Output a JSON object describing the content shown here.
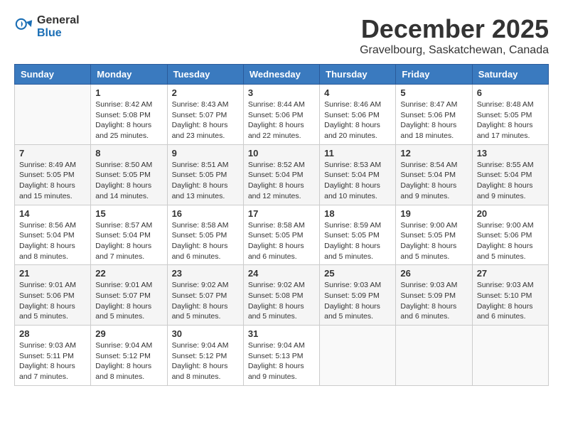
{
  "header": {
    "logo_line1": "General",
    "logo_line2": "Blue",
    "month": "December 2025",
    "location": "Gravelbourg, Saskatchewan, Canada"
  },
  "days_of_week": [
    "Sunday",
    "Monday",
    "Tuesday",
    "Wednesday",
    "Thursday",
    "Friday",
    "Saturday"
  ],
  "weeks": [
    [
      {
        "day": "",
        "sunrise": "",
        "sunset": "",
        "daylight": ""
      },
      {
        "day": "1",
        "sunrise": "Sunrise: 8:42 AM",
        "sunset": "Sunset: 5:08 PM",
        "daylight": "Daylight: 8 hours and 25 minutes."
      },
      {
        "day": "2",
        "sunrise": "Sunrise: 8:43 AM",
        "sunset": "Sunset: 5:07 PM",
        "daylight": "Daylight: 8 hours and 23 minutes."
      },
      {
        "day": "3",
        "sunrise": "Sunrise: 8:44 AM",
        "sunset": "Sunset: 5:06 PM",
        "daylight": "Daylight: 8 hours and 22 minutes."
      },
      {
        "day": "4",
        "sunrise": "Sunrise: 8:46 AM",
        "sunset": "Sunset: 5:06 PM",
        "daylight": "Daylight: 8 hours and 20 minutes."
      },
      {
        "day": "5",
        "sunrise": "Sunrise: 8:47 AM",
        "sunset": "Sunset: 5:06 PM",
        "daylight": "Daylight: 8 hours and 18 minutes."
      },
      {
        "day": "6",
        "sunrise": "Sunrise: 8:48 AM",
        "sunset": "Sunset: 5:05 PM",
        "daylight": "Daylight: 8 hours and 17 minutes."
      }
    ],
    [
      {
        "day": "7",
        "sunrise": "Sunrise: 8:49 AM",
        "sunset": "Sunset: 5:05 PM",
        "daylight": "Daylight: 8 hours and 15 minutes."
      },
      {
        "day": "8",
        "sunrise": "Sunrise: 8:50 AM",
        "sunset": "Sunset: 5:05 PM",
        "daylight": "Daylight: 8 hours and 14 minutes."
      },
      {
        "day": "9",
        "sunrise": "Sunrise: 8:51 AM",
        "sunset": "Sunset: 5:05 PM",
        "daylight": "Daylight: 8 hours and 13 minutes."
      },
      {
        "day": "10",
        "sunrise": "Sunrise: 8:52 AM",
        "sunset": "Sunset: 5:04 PM",
        "daylight": "Daylight: 8 hours and 12 minutes."
      },
      {
        "day": "11",
        "sunrise": "Sunrise: 8:53 AM",
        "sunset": "Sunset: 5:04 PM",
        "daylight": "Daylight: 8 hours and 10 minutes."
      },
      {
        "day": "12",
        "sunrise": "Sunrise: 8:54 AM",
        "sunset": "Sunset: 5:04 PM",
        "daylight": "Daylight: 8 hours and 9 minutes."
      },
      {
        "day": "13",
        "sunrise": "Sunrise: 8:55 AM",
        "sunset": "Sunset: 5:04 PM",
        "daylight": "Daylight: 8 hours and 9 minutes."
      }
    ],
    [
      {
        "day": "14",
        "sunrise": "Sunrise: 8:56 AM",
        "sunset": "Sunset: 5:04 PM",
        "daylight": "Daylight: 8 hours and 8 minutes."
      },
      {
        "day": "15",
        "sunrise": "Sunrise: 8:57 AM",
        "sunset": "Sunset: 5:04 PM",
        "daylight": "Daylight: 8 hours and 7 minutes."
      },
      {
        "day": "16",
        "sunrise": "Sunrise: 8:58 AM",
        "sunset": "Sunset: 5:05 PM",
        "daylight": "Daylight: 8 hours and 6 minutes."
      },
      {
        "day": "17",
        "sunrise": "Sunrise: 8:58 AM",
        "sunset": "Sunset: 5:05 PM",
        "daylight": "Daylight: 8 hours and 6 minutes."
      },
      {
        "day": "18",
        "sunrise": "Sunrise: 8:59 AM",
        "sunset": "Sunset: 5:05 PM",
        "daylight": "Daylight: 8 hours and 5 minutes."
      },
      {
        "day": "19",
        "sunrise": "Sunrise: 9:00 AM",
        "sunset": "Sunset: 5:05 PM",
        "daylight": "Daylight: 8 hours and 5 minutes."
      },
      {
        "day": "20",
        "sunrise": "Sunrise: 9:00 AM",
        "sunset": "Sunset: 5:06 PM",
        "daylight": "Daylight: 8 hours and 5 minutes."
      }
    ],
    [
      {
        "day": "21",
        "sunrise": "Sunrise: 9:01 AM",
        "sunset": "Sunset: 5:06 PM",
        "daylight": "Daylight: 8 hours and 5 minutes."
      },
      {
        "day": "22",
        "sunrise": "Sunrise: 9:01 AM",
        "sunset": "Sunset: 5:07 PM",
        "daylight": "Daylight: 8 hours and 5 minutes."
      },
      {
        "day": "23",
        "sunrise": "Sunrise: 9:02 AM",
        "sunset": "Sunset: 5:07 PM",
        "daylight": "Daylight: 8 hours and 5 minutes."
      },
      {
        "day": "24",
        "sunrise": "Sunrise: 9:02 AM",
        "sunset": "Sunset: 5:08 PM",
        "daylight": "Daylight: 8 hours and 5 minutes."
      },
      {
        "day": "25",
        "sunrise": "Sunrise: 9:03 AM",
        "sunset": "Sunset: 5:09 PM",
        "daylight": "Daylight: 8 hours and 5 minutes."
      },
      {
        "day": "26",
        "sunrise": "Sunrise: 9:03 AM",
        "sunset": "Sunset: 5:09 PM",
        "daylight": "Daylight: 8 hours and 6 minutes."
      },
      {
        "day": "27",
        "sunrise": "Sunrise: 9:03 AM",
        "sunset": "Sunset: 5:10 PM",
        "daylight": "Daylight: 8 hours and 6 minutes."
      }
    ],
    [
      {
        "day": "28",
        "sunrise": "Sunrise: 9:03 AM",
        "sunset": "Sunset: 5:11 PM",
        "daylight": "Daylight: 8 hours and 7 minutes."
      },
      {
        "day": "29",
        "sunrise": "Sunrise: 9:04 AM",
        "sunset": "Sunset: 5:12 PM",
        "daylight": "Daylight: 8 hours and 8 minutes."
      },
      {
        "day": "30",
        "sunrise": "Sunrise: 9:04 AM",
        "sunset": "Sunset: 5:12 PM",
        "daylight": "Daylight: 8 hours and 8 minutes."
      },
      {
        "day": "31",
        "sunrise": "Sunrise: 9:04 AM",
        "sunset": "Sunset: 5:13 PM",
        "daylight": "Daylight: 8 hours and 9 minutes."
      },
      {
        "day": "",
        "sunrise": "",
        "sunset": "",
        "daylight": ""
      },
      {
        "day": "",
        "sunrise": "",
        "sunset": "",
        "daylight": ""
      },
      {
        "day": "",
        "sunrise": "",
        "sunset": "",
        "daylight": ""
      }
    ]
  ]
}
